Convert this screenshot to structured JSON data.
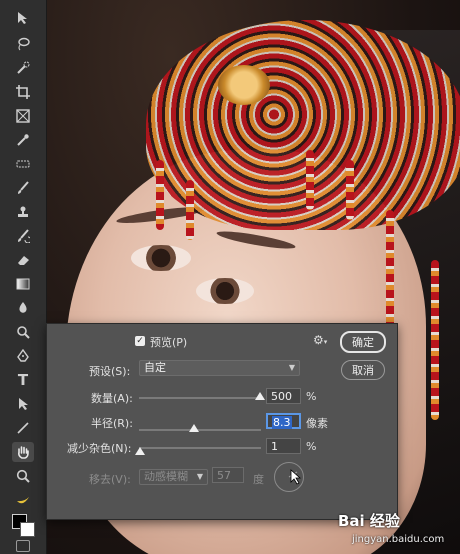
{
  "toolbar": {
    "tools": [
      "move-icon",
      "lasso-icon",
      "quick-select-icon",
      "crop-icon",
      "frame-icon",
      "eyedropper-icon",
      "healing-icon",
      "brush-icon",
      "stamp-icon",
      "history-brush-icon",
      "eraser-icon",
      "gradient-icon",
      "blur-icon",
      "dodge-icon",
      "pen-icon",
      "type-icon",
      "path-select-icon",
      "line-icon",
      "hand-icon",
      "zoom-icon",
      "banana-icon"
    ],
    "type_glyph": "T"
  },
  "dialog": {
    "preview_label": "预览(P)",
    "preview_checked": true,
    "ok_label": "确定",
    "cancel_label": "取消",
    "preset_label": "预设(S):",
    "preset_value": "自定",
    "amount_label": "数量(A):",
    "amount_value": "500",
    "amount_unit": "%",
    "amount_fraction": 0.99,
    "radius_label": "半径(R):",
    "radius_value": "8.3",
    "radius_unit": "像素",
    "radius_fraction": 0.45,
    "noise_label": "减少杂色(N):",
    "noise_value": "1",
    "noise_unit": "%",
    "noise_fraction": 0.01,
    "remove_label": "移去(V):",
    "remove_value": "动感模糊",
    "angle_value": "57",
    "angle_unit": "度"
  },
  "watermark": {
    "main": "Bai 经验",
    "sub": "jingyan.baidu.com"
  }
}
